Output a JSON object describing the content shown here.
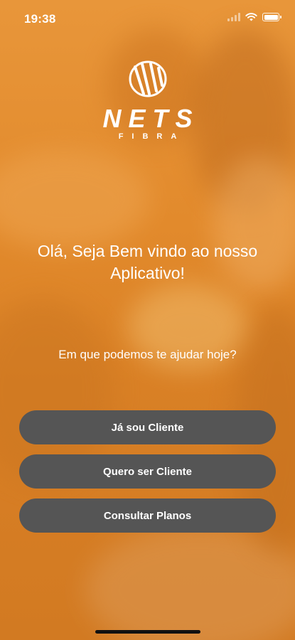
{
  "status_bar": {
    "time": "19:38",
    "icons": [
      "cellular-signal-icon",
      "wifi-icon",
      "battery-icon"
    ]
  },
  "brand": {
    "logo_icon": "globe-logo-icon",
    "name": "NETS",
    "subtitle": "FIBRA",
    "accent_color": "#E38B2E"
  },
  "main": {
    "welcome": "Olá, Seja Bem vindo ao nosso Aplicativo!",
    "help_prompt": "Em que podemos te ajudar hoje?"
  },
  "actions": {
    "existing_client": "Já sou Cliente",
    "become_client": "Quero ser Cliente",
    "view_plans": "Consultar Planos"
  },
  "colors": {
    "button_bg": "#555555",
    "text": "#FFFFFF"
  }
}
